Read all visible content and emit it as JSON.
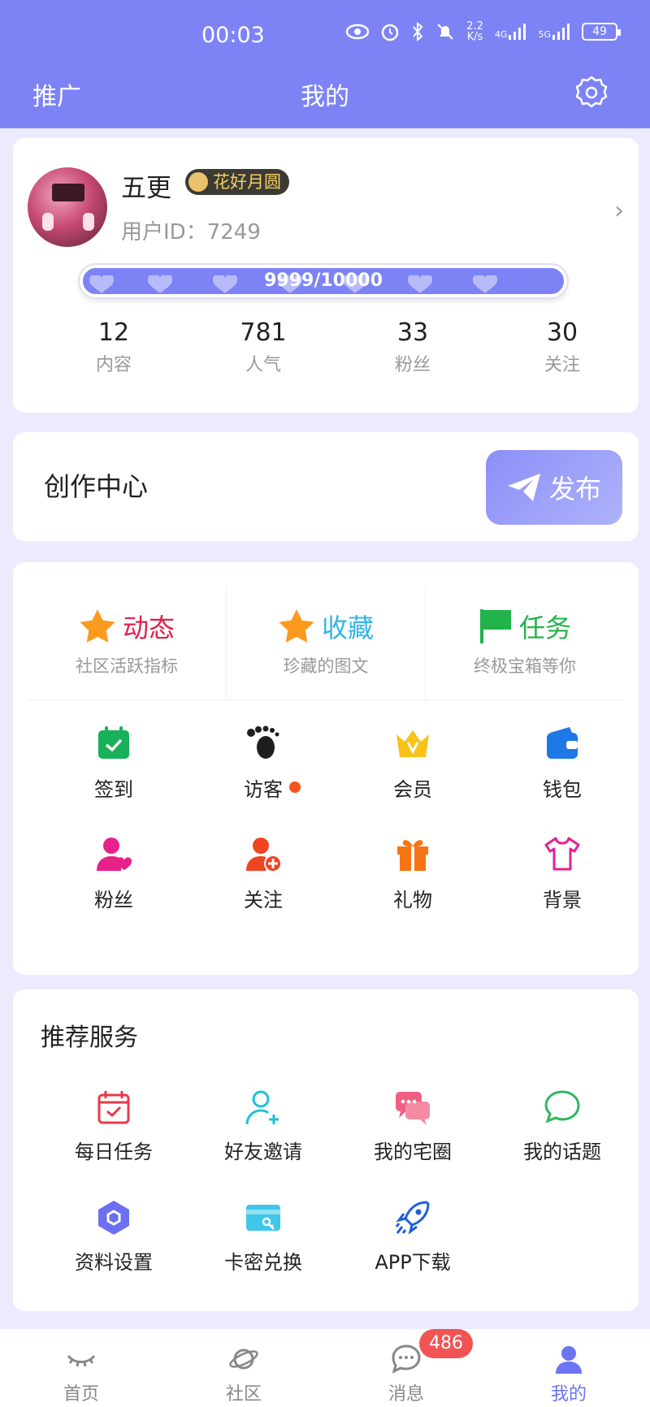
{
  "status": {
    "time": "00:03",
    "speed_top": "2.2",
    "speed_bottom": "K/s",
    "net1": "4G",
    "net2": "5G",
    "battery": "49"
  },
  "nav": {
    "left": "推广",
    "title": "我的"
  },
  "profile": {
    "name": "五更",
    "badge": "花好月圆",
    "user_id": "用户ID：7249",
    "exp": "9999/10000",
    "exp_fraction": 0.9999,
    "stats": [
      {
        "value": "12",
        "label": "内容"
      },
      {
        "value": "781",
        "label": "人气"
      },
      {
        "value": "33",
        "label": "粉丝"
      },
      {
        "value": "30",
        "label": "关注"
      }
    ]
  },
  "creation": {
    "title": "创作中心",
    "publish": "发布"
  },
  "features": [
    {
      "title": "动态",
      "sub": "社区活跃指标",
      "color": "#e0204a",
      "icon": "star-icon"
    },
    {
      "title": "收藏",
      "sub": "珍藏的图文",
      "color": "#36b4e8",
      "icon": "star-icon"
    },
    {
      "title": "任务",
      "sub": "终极宝箱等你",
      "color": "#21b24a",
      "icon": "flag-icon"
    }
  ],
  "grid": [
    {
      "label": "签到",
      "icon": "calendar-check-icon"
    },
    {
      "label": "访客",
      "icon": "footprint-icon"
    },
    {
      "label": "会员",
      "icon": "crown-icon"
    },
    {
      "label": "钱包",
      "icon": "wallet-icon"
    },
    {
      "label": "粉丝",
      "icon": "fan-user-icon"
    },
    {
      "label": "关注",
      "icon": "add-user-icon"
    },
    {
      "label": "礼物",
      "icon": "gift-icon"
    },
    {
      "label": "背景",
      "icon": "tshirt-icon"
    }
  ],
  "services": {
    "title": "推荐服务",
    "items": [
      {
        "label": "每日任务",
        "icon": "calendar-icon"
      },
      {
        "label": "好友邀请",
        "icon": "invite-user-icon"
      },
      {
        "label": "我的宅圈",
        "icon": "chat-bubbles-icon"
      },
      {
        "label": "我的话题",
        "icon": "speech-bubble-icon"
      },
      {
        "label": "资料设置",
        "icon": "hexagon-icon"
      },
      {
        "label": "卡密兑换",
        "icon": "card-key-icon"
      },
      {
        "label": "APP下载",
        "icon": "rocket-icon"
      }
    ]
  },
  "tabs": [
    {
      "label": "首页",
      "icon": "eye-closed-icon"
    },
    {
      "label": "社区",
      "icon": "planet-icon"
    },
    {
      "label": "消息",
      "icon": "message-icon",
      "badge": "486"
    },
    {
      "label": "我的",
      "icon": "user-icon",
      "active": true
    }
  ],
  "colors": {
    "brand": "#7d83f5",
    "tab_active": "#6d74f2",
    "badge_red": "#f25454"
  }
}
